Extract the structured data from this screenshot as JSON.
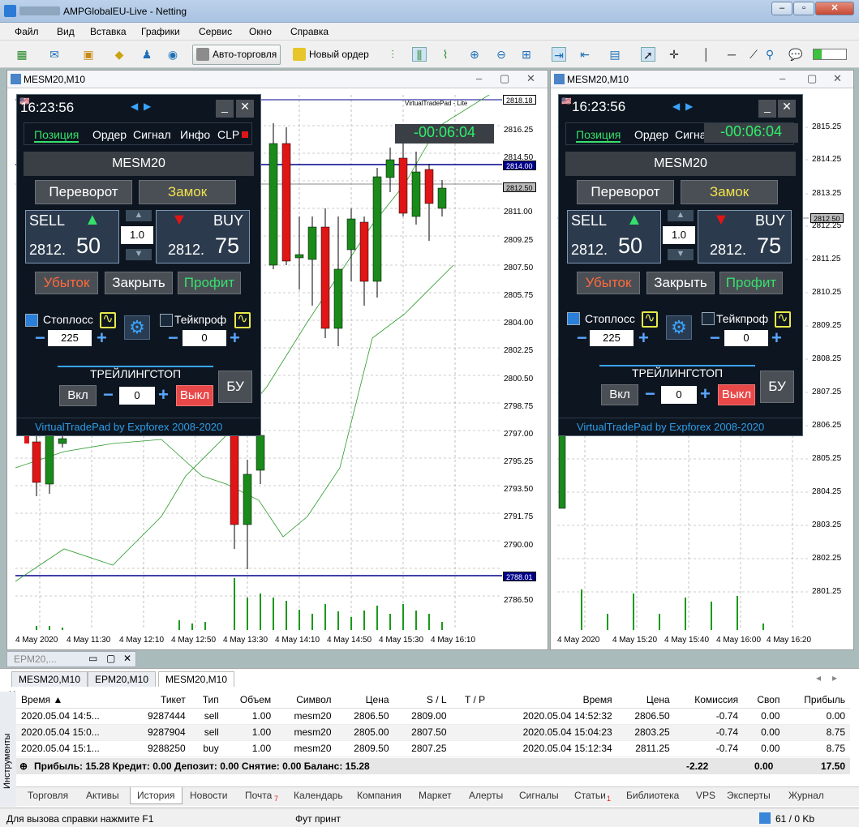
{
  "window": {
    "title": "AMPGlobalEU-Live - Netting"
  },
  "menu": [
    "Файл",
    "Вид",
    "Вставка",
    "Графики",
    "Сервис",
    "Окно",
    "Справка"
  ],
  "toolbar": {
    "auto_trading": "Авто-торговля",
    "new_order": "Новый ордер"
  },
  "chart_left": {
    "title": "MESM20,M10",
    "indicator_label": "VirtualTradePad - Lite",
    "price_ticks": [
      "2816.25",
      "2814.50",
      "2814.00",
      "2813.50",
      "2812.50",
      "2811.00",
      "2809.25",
      "2807.50",
      "2805.75",
      "2804.00",
      "2802.25",
      "2800.50",
      "2798.75",
      "2797.00",
      "2795.25",
      "2793.50",
      "2791.75",
      "2790.00",
      "2788.01",
      "2786.50"
    ],
    "top_box": "2818.18",
    "time_ticks": [
      "4 May 2020",
      "4 May 11:30",
      "4 May 12:10",
      "4 May 12:50",
      "4 May 13:30",
      "4 May 14:10",
      "4 May 14:50",
      "4 May 15:30",
      "4 May 16:10"
    ]
  },
  "chart_right": {
    "title": "MESM20,M10",
    "price_ticks": [
      "2815.25",
      "2814.25",
      "2813.25",
      "2812.50",
      "2812.25",
      "2811.25",
      "2810.25",
      "2809.25",
      "2808.25",
      "2807.25",
      "2806.25",
      "2805.25",
      "2804.25",
      "2803.25",
      "2802.25",
      "2801.25"
    ],
    "time_ticks": [
      "4 May 2020",
      "4 May 15:20",
      "4 May 15:40",
      "4 May 16:00",
      "4 May 16:20"
    ]
  },
  "panel": {
    "time": "16:23:56",
    "timer": "-00:06:04",
    "tabs": [
      "Позиция",
      "Ордер",
      "Сигнал",
      "Инфо",
      "CLP"
    ],
    "tabs_right": [
      "Позиция",
      "Ордер",
      "Сигна"
    ],
    "symbol": "MESM20",
    "reverse": "Переворот",
    "lock": "Замок",
    "sell_label": "SELL",
    "buy_label": "BUY",
    "sell_price_main": "2812.",
    "sell_price_big": "50",
    "buy_price_main": "2812.",
    "buy_price_big": "75",
    "lot": "1.0",
    "loss": "Убыток",
    "close": "Закрыть",
    "profit": "Профит",
    "stoploss": "Стоплосс",
    "takeprofit": "Тейкпроф",
    "sl_value": "225",
    "tp_value": "0",
    "trailing": "ТРЕЙЛИНГСТОП",
    "on": "Вкл",
    "off": "Выкл",
    "trail_value": "0",
    "bu": "БУ",
    "footer": "VirtualTradePad by Expforex 2008-2020",
    "title_btn_min": "_",
    "title_btn_close": "✕"
  },
  "chart_tabs": [
    "MESM20,M10",
    "EPM20,M10",
    "MESM20,M10"
  ],
  "minimized_window": "EPM20,...",
  "history": {
    "headers": [
      "Время",
      "Тикет",
      "Тип",
      "Объем",
      "Символ",
      "Цена",
      "S / L",
      "T / P",
      "Время",
      "Цена",
      "Комиссия",
      "Своп",
      "Прибыль"
    ],
    "rows": [
      [
        "2020.05.04 14:5...",
        "9287444",
        "sell",
        "1.00",
        "mesm20",
        "2806.50",
        "2809.00",
        "",
        "2020.05.04 14:52:32",
        "2806.50",
        "-0.74",
        "0.00",
        "0.00"
      ],
      [
        "2020.05.04 15:0...",
        "9287904",
        "sell",
        "1.00",
        "mesm20",
        "2805.00",
        "2807.50",
        "",
        "2020.05.04 15:04:23",
        "2803.25",
        "-0.74",
        "0.00",
        "8.75"
      ],
      [
        "2020.05.04 15:1...",
        "9288250",
        "buy",
        "1.00",
        "mesm20",
        "2809.50",
        "2807.25",
        "",
        "2020.05.04 15:12:34",
        "2811.25",
        "-0.74",
        "0.00",
        "8.75"
      ]
    ],
    "summary": {
      "text": "Прибыль: 15.28  Кредит: 0.00  Депозит: 0.00  Снятие: 0.00  Баланс: 15.28",
      "commission": "-2.22",
      "swap": "0.00",
      "profit": "17.50"
    }
  },
  "side_label": "Инструменты",
  "bottom_tabs": [
    "Торговля",
    "Активы",
    "История",
    "Новости",
    "Почта",
    "Календарь",
    "Компания",
    "Маркет",
    "Алерты",
    "Сигналы",
    "Статьи",
    "Библиотека",
    "VPS",
    "Эксперты",
    "Журнал"
  ],
  "bottom_badges": {
    "mail": "7",
    "articles": "1"
  },
  "status": {
    "help": "Для вызова справки нажмите F1",
    "profile": "Фут принт",
    "traffic": "61 / 0 Kb"
  },
  "colors": {
    "bull": "#1a8a1a",
    "bear": "#e01515",
    "panel_bg": "#0d1620",
    "accent_green": "#35e06a"
  }
}
